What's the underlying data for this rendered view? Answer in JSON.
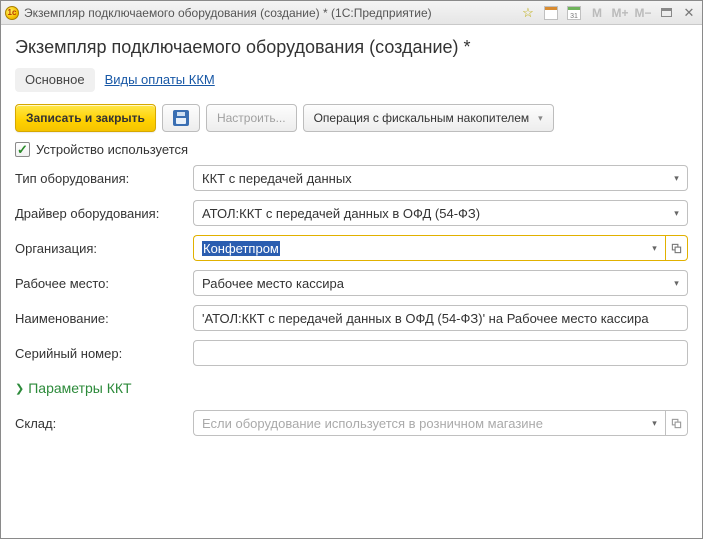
{
  "titlebar": {
    "logo_text": "1c",
    "title": "Экземпляр подключаемого оборудования (создание) * (1С:Предприятие)",
    "cal_day": "31"
  },
  "header": {
    "title": "Экземпляр подключаемого оборудования (создание) *"
  },
  "tabs": {
    "main": "Основное",
    "pay": "Виды оплаты ККМ"
  },
  "toolbar": {
    "save_close": "Записать и закрыть",
    "configure": "Настроить...",
    "fiscal_op": "Операция с фискальным накопителем"
  },
  "device_used": {
    "label": "Устройство используется",
    "checked": true
  },
  "labels": {
    "type": "Тип оборудования:",
    "driver": "Драйвер оборудования:",
    "org": "Организация:",
    "workplace": "Рабочее место:",
    "name": "Наименование:",
    "serial": "Серийный номер:",
    "warehouse": "Склад:"
  },
  "values": {
    "type": "ККТ с передачей данных",
    "driver": "АТОЛ:ККТ с передачей данных в ОФД (54-ФЗ)",
    "org": "Конфетпром",
    "workplace": "Рабочее место кассира",
    "name": "'АТОЛ:ККТ с передачей данных в ОФД (54-ФЗ)' на Рабочее место кассира",
    "serial": "",
    "warehouse_placeholder": "Если оборудование используется в розничном магазине"
  },
  "expander": {
    "kkt_params": "Параметры ККТ"
  }
}
